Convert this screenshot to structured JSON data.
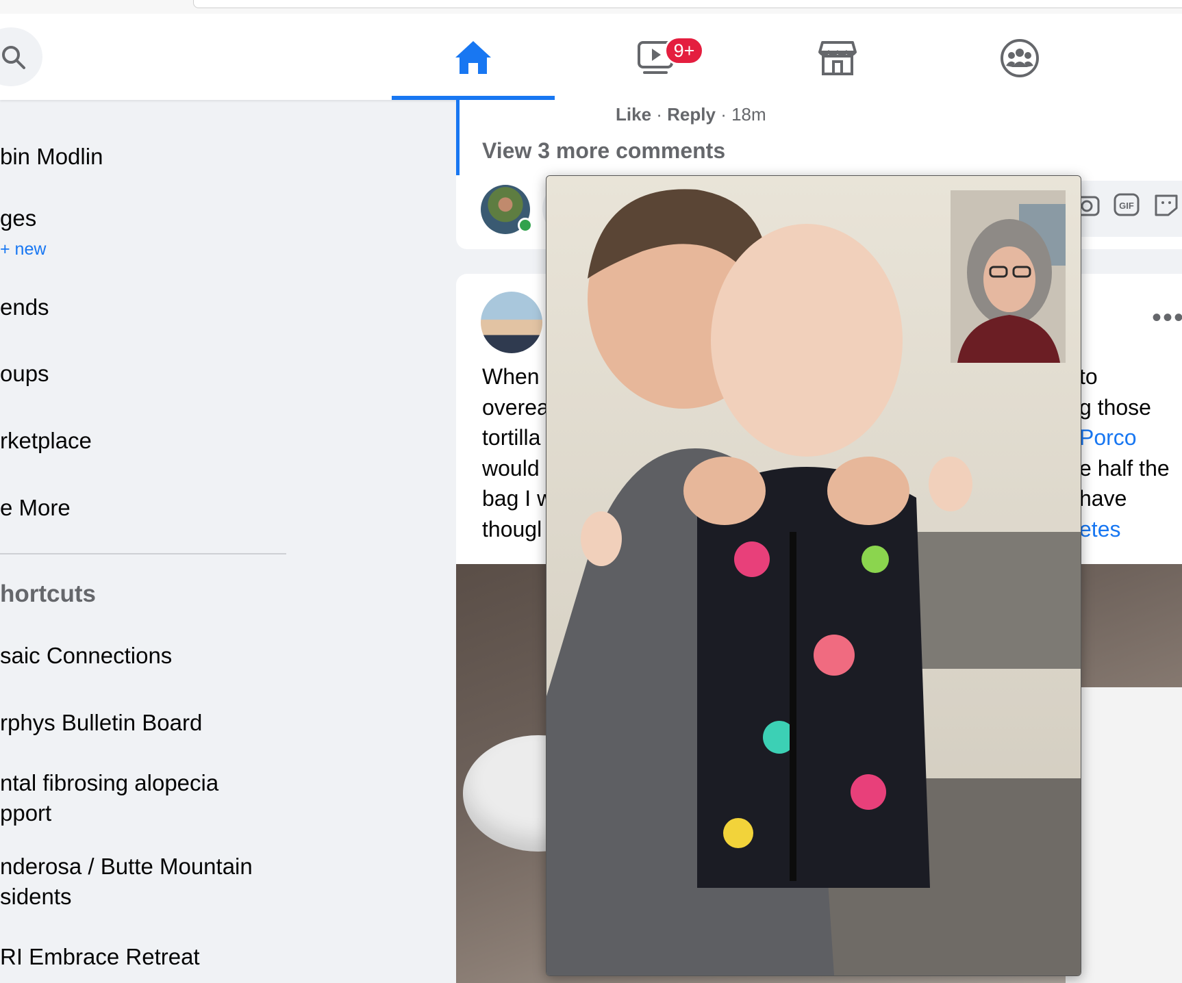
{
  "nav": {
    "tabs": [
      {
        "name": "home",
        "active": true
      },
      {
        "name": "watch",
        "badge": "9+"
      },
      {
        "name": "marketplace"
      },
      {
        "name": "groups"
      }
    ]
  },
  "sidebar": {
    "items": [
      {
        "label": "bin Modlin"
      },
      {
        "label": "ges",
        "sub": "+ new"
      },
      {
        "label": "ends"
      },
      {
        "label": "oups"
      },
      {
        "label": "rketplace"
      },
      {
        "label": "e More"
      }
    ],
    "shortcuts_heading": "hortcuts",
    "shortcuts": [
      "saic Connections",
      "rphys Bulletin Board",
      "ntal fibrosing alopecia\npport",
      "nderosa / Butte Mountain\nsidents",
      "RI Embrace Retreat"
    ]
  },
  "feed": {
    "comment_meta": {
      "like": "Like",
      "reply": "Reply",
      "time": "18m"
    },
    "view_more": "View 3 more comments",
    "post": {
      "more": "•••",
      "left_lines": "When\noverea\ntortilla\nwould\nbag I w\nthougl",
      "right_l1": "to",
      "right_l2": "g those",
      "right_l3": "Porco",
      "right_l4": "e half the",
      "right_l5": "have",
      "right_l6": "etes"
    }
  },
  "colors": {
    "accent": "#1877f2",
    "badge": "#e41e3f",
    "online": "#31a24c"
  }
}
